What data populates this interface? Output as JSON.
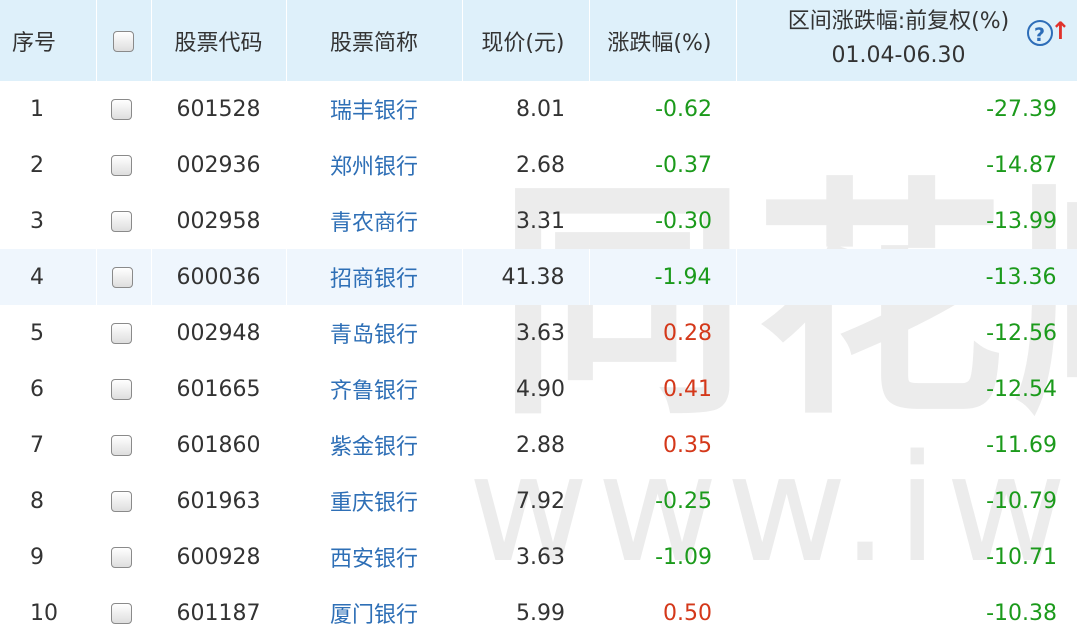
{
  "watermark": {
    "brand": "同花顺",
    "site": "www.iwen"
  },
  "header": {
    "index": "序号",
    "code": "股票代码",
    "name": "股票简称",
    "price": "现价(元)",
    "change": "涨跌幅(%)",
    "range_title": "区间涨跌幅:前复权(%)",
    "range_date": "01.04-06.30",
    "help_icon": "?",
    "sort_icon": "↑"
  },
  "colors": {
    "header_bg": "#def0fa",
    "name_link": "#2e6fb6",
    "negative": "#1b9a1b",
    "positive": "#d4381a",
    "highlight_row": "#eff6fd"
  },
  "rows": [
    {
      "index": "1",
      "code": "601528",
      "name": "瑞丰银行",
      "price": "8.01",
      "change": "-0.62",
      "range": "-27.39"
    },
    {
      "index": "2",
      "code": "002936",
      "name": "郑州银行",
      "price": "2.68",
      "change": "-0.37",
      "range": "-14.87"
    },
    {
      "index": "3",
      "code": "002958",
      "name": "青农商行",
      "price": "3.31",
      "change": "-0.30",
      "range": "-13.99"
    },
    {
      "index": "4",
      "code": "600036",
      "name": "招商银行",
      "price": "41.38",
      "change": "-1.94",
      "range": "-13.36"
    },
    {
      "index": "5",
      "code": "002948",
      "name": "青岛银行",
      "price": "3.63",
      "change": "0.28",
      "range": "-12.56"
    },
    {
      "index": "6",
      "code": "601665",
      "name": "齐鲁银行",
      "price": "4.90",
      "change": "0.41",
      "range": "-12.54"
    },
    {
      "index": "7",
      "code": "601860",
      "name": "紫金银行",
      "price": "2.88",
      "change": "0.35",
      "range": "-11.69"
    },
    {
      "index": "8",
      "code": "601963",
      "name": "重庆银行",
      "price": "7.92",
      "change": "-0.25",
      "range": "-10.79"
    },
    {
      "index": "9",
      "code": "600928",
      "name": "西安银行",
      "price": "3.63",
      "change": "-1.09",
      "range": "-10.71"
    },
    {
      "index": "10",
      "code": "601187",
      "name": "厦门银行",
      "price": "5.99",
      "change": "0.50",
      "range": "-10.38"
    }
  ]
}
